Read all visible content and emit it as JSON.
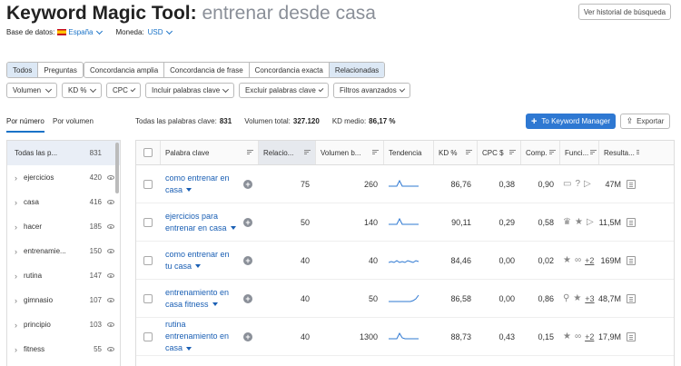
{
  "header": {
    "title_main": "Keyword Magic Tool:",
    "title_query": "entrenar desde casa",
    "history_button": "Ver historial de búsqueda",
    "db_label": "Base de datos:",
    "db_value": "España",
    "currency_label": "Moneda:",
    "currency_value": "USD"
  },
  "match_tabs": [
    "Todos",
    "Preguntas"
  ],
  "concordance_tabs": [
    "Concordancia amplia",
    "Concordancia de frase",
    "Concordancia exacta",
    "Relacionadas"
  ],
  "filters": [
    "Volumen",
    "KD %",
    "CPC",
    "Incluir palabras clave",
    "Excluir palabras clave",
    "Filtros avanzados"
  ],
  "sort_tabs": [
    "Por número",
    "Por volumen"
  ],
  "stats": {
    "all_label": "Todas las palabras clave:",
    "all_value": "831",
    "vol_label": "Volumen total:",
    "vol_value": "327.120",
    "kd_label": "KD medio:",
    "kd_value": "86,17 %"
  },
  "actions": {
    "km_button": "To Keyword Manager",
    "export_button": "Exportar"
  },
  "sidebar": {
    "items": [
      {
        "label": "Todas las p...",
        "count": "831"
      },
      {
        "label": "ejercicios",
        "count": "420"
      },
      {
        "label": "casa",
        "count": "416"
      },
      {
        "label": "hacer",
        "count": "185"
      },
      {
        "label": "entrenamie...",
        "count": "150"
      },
      {
        "label": "rutina",
        "count": "147"
      },
      {
        "label": "gimnasio",
        "count": "107"
      },
      {
        "label": "principio",
        "count": "103"
      },
      {
        "label": "fitness",
        "count": "55"
      }
    ]
  },
  "table": {
    "headers": [
      "Palabra clave",
      "Relacio...",
      "Volumen b...",
      "Tendencia",
      "KD %",
      "CPC $",
      "Comp.",
      "Funci...",
      "Resulta..."
    ],
    "rows": [
      {
        "kw1": "como entrenar en",
        "kw2": "casa",
        "rel": "75",
        "vol": "260",
        "kd": "86,76",
        "cpc": "0,38",
        "comp": "0,90",
        "more": "",
        "res": "47M",
        "trend": [
          3,
          3,
          3,
          3,
          9,
          3,
          3,
          3,
          3,
          3,
          3,
          3
        ]
      },
      {
        "kw1": "ejercicios para",
        "kw2": "entrenar en casa",
        "rel": "50",
        "vol": "140",
        "kd": "90,11",
        "cpc": "0,29",
        "comp": "0,58",
        "more": "",
        "res": "11,5M",
        "trend": [
          3,
          3,
          3,
          3,
          9,
          3,
          3,
          3,
          3,
          3,
          3,
          3
        ]
      },
      {
        "kw1": "como entrenar en",
        "kw2": "tu casa",
        "rel": "40",
        "vol": "40",
        "kd": "84,46",
        "cpc": "0,00",
        "comp": "0,02",
        "more": "+2",
        "res": "169M",
        "trend": [
          3,
          4,
          3,
          5,
          3,
          4,
          3,
          5,
          4,
          3,
          5,
          4
        ]
      },
      {
        "kw1": "entrenamiento en",
        "kw2": "casa fitness",
        "rel": "40",
        "vol": "50",
        "kd": "86,58",
        "cpc": "0,00",
        "comp": "0,86",
        "more": "+3",
        "res": "48,7M",
        "trend": [
          2,
          2,
          2,
          2,
          2,
          2,
          2,
          2,
          2,
          3,
          5,
          9
        ]
      },
      {
        "kw1": "rutina",
        "kw2": "entrenamiento en",
        "kw3": "casa",
        "rel": "40",
        "vol": "1300",
        "kd": "88,73",
        "cpc": "0,43",
        "comp": "0,15",
        "more": "+2",
        "res": "17,9M",
        "trend": [
          3,
          3,
          3,
          3,
          9,
          4,
          3,
          3,
          3,
          3,
          3,
          3
        ]
      }
    ]
  },
  "colors": {
    "accent": "#2e78d2",
    "link": "#1a5fb4",
    "active_tab": "#dce8f5"
  }
}
